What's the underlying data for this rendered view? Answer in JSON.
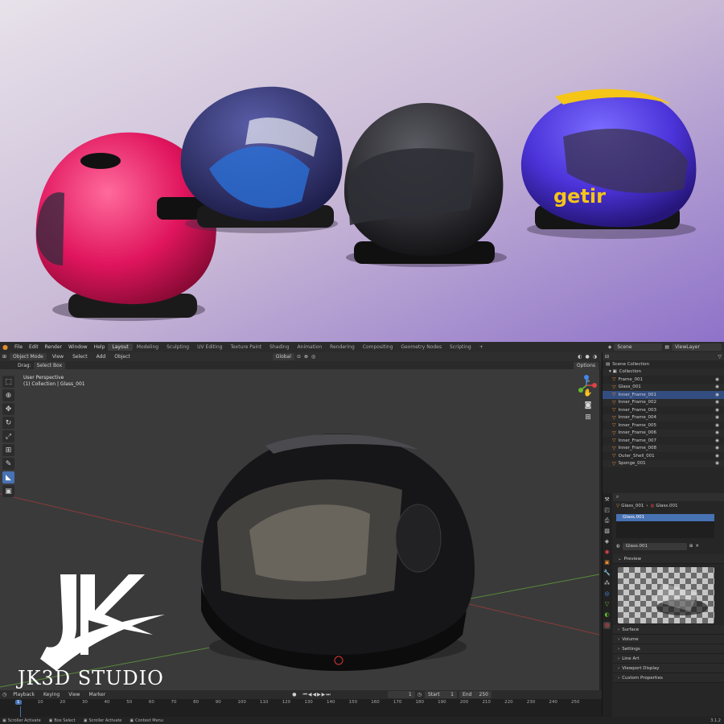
{
  "logo": {
    "brand": "JK3D STUDIO"
  },
  "topbar": {
    "menus": [
      "File",
      "Edit",
      "Render",
      "Window",
      "Help"
    ],
    "workspaces": [
      "Layout",
      "Modeling",
      "Sculpting",
      "UV Editing",
      "Texture Paint",
      "Shading",
      "Animation",
      "Rendering",
      "Compositing",
      "Geometry Nodes",
      "Scripting"
    ],
    "add_tab": "+",
    "scene_label": "Scene",
    "viewlayer_label": "ViewLayer"
  },
  "viewport_header": {
    "mode": "Object Mode",
    "menus": [
      "View",
      "Select",
      "Add",
      "Object"
    ],
    "orientation": "Global",
    "options": "Options"
  },
  "tool_settings": {
    "drag_label": "Drag:",
    "drag_value": "Select Box"
  },
  "viewport": {
    "perspective": "User Perspective",
    "collection_info": "(1) Collection | Glass_001",
    "axis_x": "X",
    "axis_y": "Y",
    "axis_z": "Z"
  },
  "outliner": {
    "scene_collection": "Scene Collection",
    "collection": "Collection",
    "items": [
      "Frame_001",
      "Glass_001",
      "Inner_Frame_001",
      "Inner_Frame_002",
      "Inner_Frame_003",
      "Inner_Frame_004",
      "Inner_Frame_005",
      "Inner_Frame_006",
      "Inner_Frame_007",
      "Inner_Frame_008",
      "Outer_Shell_001",
      "Sponge_001"
    ]
  },
  "properties": {
    "breadcrumb_object": "Glass_001",
    "breadcrumb_material": "Glass.001",
    "slot": "Glass.001",
    "material_name": "Glass.001",
    "preview": "Preview",
    "sections": [
      "Surface",
      "Volume",
      "Settings",
      "Line Art",
      "Viewport Display",
      "Custom Properties"
    ]
  },
  "timeline": {
    "menus": [
      "Playback",
      "Keying",
      "View",
      "Marker"
    ],
    "current_frame": "1",
    "start_label": "Start",
    "start": "1",
    "end_label": "End",
    "end": "250",
    "ruler": [
      "1",
      "10",
      "20",
      "30",
      "40",
      "50",
      "60",
      "70",
      "80",
      "90",
      "100",
      "110",
      "120",
      "130",
      "140",
      "150",
      "160",
      "170",
      "180",
      "190",
      "200",
      "210",
      "220",
      "230",
      "240",
      "250"
    ]
  },
  "status_bar": {
    "items": [
      "Scroller Activate",
      "Box Select",
      "Scroller Activate",
      "Context Menu"
    ],
    "version": "3.1.2"
  }
}
